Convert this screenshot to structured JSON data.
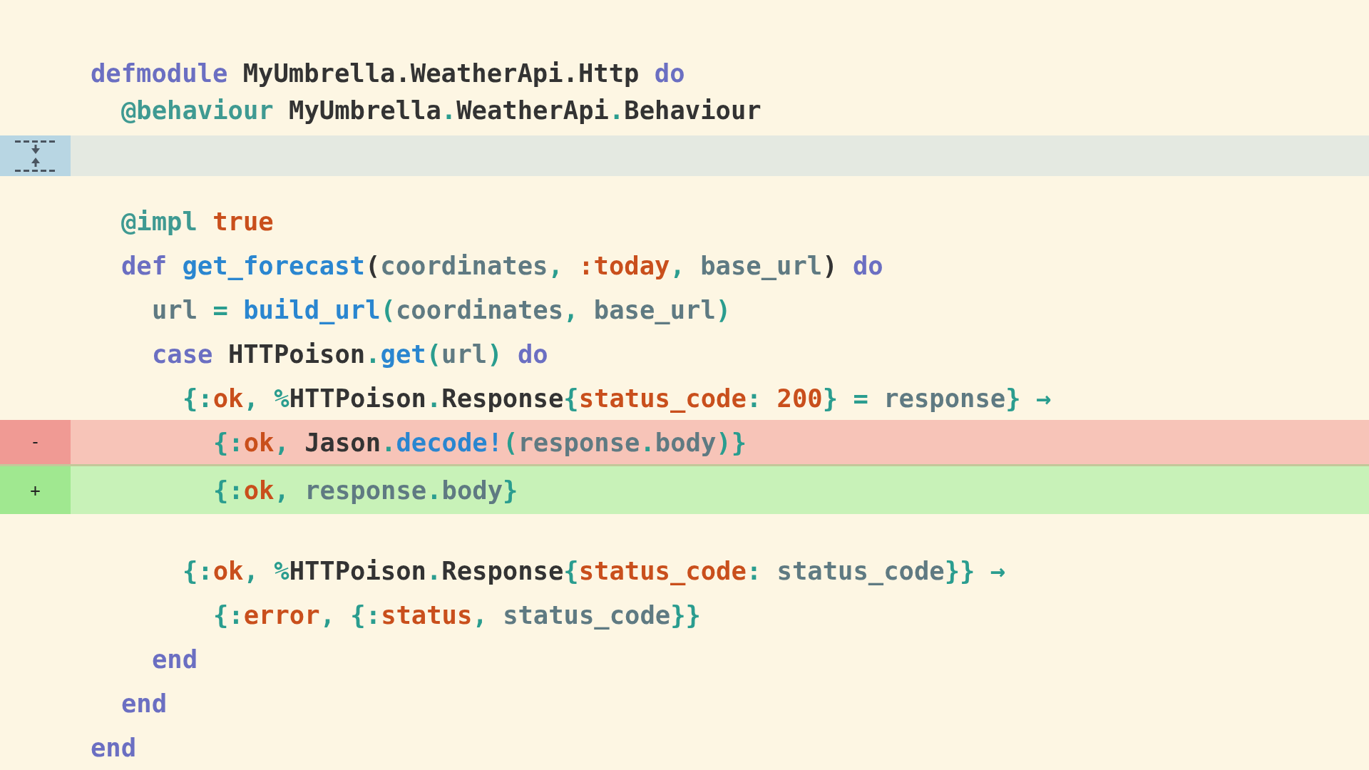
{
  "lines": [
    {
      "kind": "context",
      "tokens": [
        {
          "text": "defmodule ",
          "kind": "kw"
        },
        {
          "text": "MyUmbrella.WeatherApi.Http ",
          "kind": "mod"
        },
        {
          "text": "do",
          "kind": "kw"
        }
      ],
      "children": [
        {
          "kind": "context",
          "tokens": [
            {
              "text": "@behaviour ",
              "kind": "attr"
            },
            {
              "text": "MyUmbrella",
              "kind": "mod"
            },
            {
              "text": ".",
              "kind": "p"
            },
            {
              "text": "WeatherApi",
              "kind": "mod"
            },
            {
              "text": ".",
              "kind": "p"
            },
            {
              "text": "Behaviour",
              "kind": "mod"
            }
          ]
        },
        {
          "kind": "expander"
        },
        {
          "kind": "context",
          "tokens": [
            {
              "text": "@impl ",
              "kind": "attr"
            },
            {
              "text": "true",
              "kind": "o"
            }
          ]
        },
        {
          "kind": "context",
          "tokens": [
            {
              "text": "def ",
              "kind": "kw"
            },
            {
              "text": "get_forecast",
              "kind": "fn"
            },
            {
              "text": "(",
              "kind": "mod"
            },
            {
              "text": "coordinates",
              "kind": "v"
            },
            {
              "text": ", ",
              "kind": "p"
            },
            {
              "text": ":today",
              "kind": "o"
            },
            {
              "text": ", ",
              "kind": "p"
            },
            {
              "text": "base_url",
              "kind": "v"
            },
            {
              "text": ") ",
              "kind": "mod"
            },
            {
              "text": "do",
              "kind": "kw"
            }
          ],
          "children": [
            {
              "kind": "context",
              "tokens": [
                {
                  "text": "url ",
                  "kind": "v"
                },
                {
                  "text": "= ",
                  "kind": "p"
                },
                {
                  "text": "build_url",
                  "kind": "fn"
                },
                {
                  "text": "(",
                  "kind": "p"
                },
                {
                  "text": "coordinates",
                  "kind": "v"
                },
                {
                  "text": ", ",
                  "kind": "p"
                },
                {
                  "text": "base_url",
                  "kind": "v"
                },
                {
                  "text": ")",
                  "kind": "p"
                }
              ]
            },
            {
              "kind": "context",
              "tokens": [
                {
                  "text": "case ",
                  "kind": "kw"
                },
                {
                  "text": "HTTPoison",
                  "kind": "mod"
                },
                {
                  "text": ".",
                  "kind": "p"
                },
                {
                  "text": "get",
                  "kind": "fn"
                },
                {
                  "text": "(",
                  "kind": "p"
                },
                {
                  "text": "url",
                  "kind": "v"
                },
                {
                  "text": ") ",
                  "kind": "p"
                },
                {
                  "text": "do",
                  "kind": "kw"
                }
              ],
              "children": [
                {
                  "kind": "context",
                  "tokens": [
                    {
                      "text": "{:",
                      "kind": "p"
                    },
                    {
                      "text": "ok",
                      "kind": "o"
                    },
                    {
                      "text": ", %",
                      "kind": "p"
                    },
                    {
                      "text": "HTTPoison",
                      "kind": "mod"
                    },
                    {
                      "text": ".",
                      "kind": "p"
                    },
                    {
                      "text": "Response",
                      "kind": "mod"
                    },
                    {
                      "text": "{",
                      "kind": "p"
                    },
                    {
                      "text": "status_code",
                      "kind": "o"
                    },
                    {
                      "text": ": ",
                      "kind": "p"
                    },
                    {
                      "text": "200",
                      "kind": "o"
                    },
                    {
                      "text": "} = ",
                      "kind": "p"
                    },
                    {
                      "text": "response",
                      "kind": "v"
                    },
                    {
                      "text": "} →",
                      "kind": "p"
                    }
                  ],
                  "children": [
                    {
                      "kind": "removed",
                      "marker": "-",
                      "tokens": [
                        {
                          "text": "{:",
                          "kind": "p"
                        },
                        {
                          "text": "ok",
                          "kind": "o"
                        },
                        {
                          "text": ", ",
                          "kind": "p"
                        },
                        {
                          "text": "Jason",
                          "kind": "mod"
                        },
                        {
                          "text": ".",
                          "kind": "p"
                        },
                        {
                          "text": "decode!",
                          "kind": "fn"
                        },
                        {
                          "text": "(",
                          "kind": "p"
                        },
                        {
                          "text": "response",
                          "kind": "v"
                        },
                        {
                          "text": ".",
                          "kind": "p"
                        },
                        {
                          "text": "body",
                          "kind": "v"
                        },
                        {
                          "text": ")}",
                          "kind": "p"
                        }
                      ]
                    },
                    {
                      "kind": "added",
                      "marker": "+",
                      "tokens": [
                        {
                          "text": "{:",
                          "kind": "p"
                        },
                        {
                          "text": "ok",
                          "kind": "o"
                        },
                        {
                          "text": ", ",
                          "kind": "p"
                        },
                        {
                          "text": "response",
                          "kind": "v"
                        },
                        {
                          "text": ".",
                          "kind": "p"
                        },
                        {
                          "text": "body",
                          "kind": "v"
                        },
                        {
                          "text": "}",
                          "kind": "p"
                        }
                      ]
                    }
                  ]
                },
                {
                  "kind": "blank"
                },
                {
                  "kind": "context",
                  "tokens": [
                    {
                      "text": "{:",
                      "kind": "p"
                    },
                    {
                      "text": "ok",
                      "kind": "o"
                    },
                    {
                      "text": ", %",
                      "kind": "p"
                    },
                    {
                      "text": "HTTPoison",
                      "kind": "mod"
                    },
                    {
                      "text": ".",
                      "kind": "p"
                    },
                    {
                      "text": "Response",
                      "kind": "mod"
                    },
                    {
                      "text": "{",
                      "kind": "p"
                    },
                    {
                      "text": "status_code",
                      "kind": "o"
                    },
                    {
                      "text": ": ",
                      "kind": "p"
                    },
                    {
                      "text": "status_code",
                      "kind": "v"
                    },
                    {
                      "text": "}} →",
                      "kind": "p"
                    }
                  ],
                  "children": [
                    {
                      "kind": "context",
                      "tokens": [
                        {
                          "text": "{:",
                          "kind": "p"
                        },
                        {
                          "text": "error",
                          "kind": "o"
                        },
                        {
                          "text": ", {:",
                          "kind": "p"
                        },
                        {
                          "text": "status",
                          "kind": "o"
                        },
                        {
                          "text": ", ",
                          "kind": "p"
                        },
                        {
                          "text": "status_code",
                          "kind": "v"
                        },
                        {
                          "text": "}}",
                          "kind": "p"
                        }
                      ]
                    }
                  ]
                }
              ]
            },
            {
              "kind": "context",
              "tokens": [
                {
                  "text": "end",
                  "kind": "kw"
                }
              ]
            }
          ]
        },
        {
          "kind": "context",
          "tokens": [
            {
              "text": "end",
              "kind": "kw"
            }
          ]
        }
      ]
    },
    {
      "kind": "context",
      "tokens": [
        {
          "text": "end",
          "kind": "kw"
        }
      ]
    }
  ]
}
